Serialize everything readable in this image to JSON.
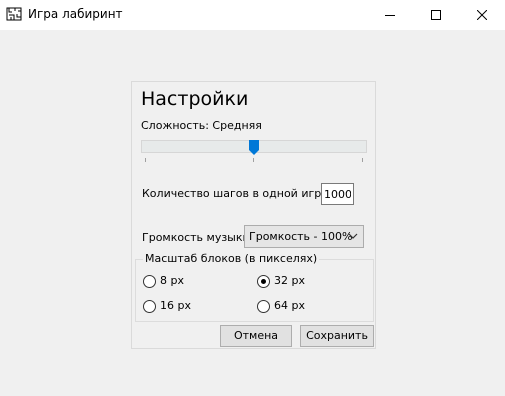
{
  "window": {
    "title": "Игра лабиринт",
    "icon": "maze-app-icon",
    "controls": [
      "minimize-icon",
      "maximize-icon",
      "close-icon"
    ]
  },
  "settings": {
    "heading": "Настройки",
    "difficulty": {
      "label": "Сложность: Средняя",
      "level": 0.5,
      "ticks": 3
    },
    "steps": {
      "label": "Количество шагов в одной игре:",
      "value": "1000"
    },
    "volume": {
      "label": "Громкость музыки:",
      "selected": "Громкость - 100%"
    },
    "block_scale": {
      "legend": "Масштаб блоков (в пикселях)",
      "options": [
        {
          "label": "8 px",
          "checked": false
        },
        {
          "label": "32 px",
          "checked": true
        },
        {
          "label": "16 px",
          "checked": false
        },
        {
          "label": "64 px",
          "checked": false
        }
      ]
    },
    "buttons": {
      "cancel": "Отмена",
      "save": "Сохранить"
    }
  }
}
